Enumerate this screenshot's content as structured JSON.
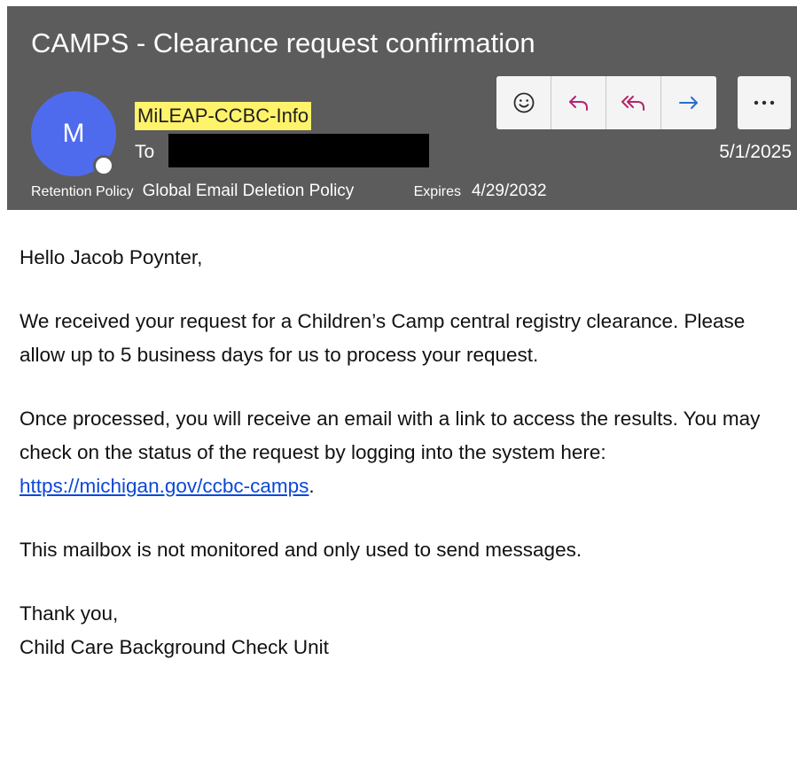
{
  "email": {
    "subject": "CAMPS - Clearance request confirmation",
    "avatar_initial": "M",
    "sender": "MiLEAP-CCBC-Info",
    "to_label": "To",
    "date": "5/1/2025",
    "retention_label": "Retention Policy",
    "retention_policy": "Global Email Deletion Policy",
    "expires_label": "Expires",
    "expires_date": "4/29/2032"
  },
  "toolbar": {
    "icons": [
      "emoji-icon",
      "reply-icon",
      "reply-all-icon",
      "forward-icon",
      "more-icon"
    ],
    "more_label": "..."
  },
  "body": {
    "greeting": "Hello Jacob Poynter,",
    "paragraph1": "We received your request for a Children’s Camp central registry clearance. Please allow up to 5 business days for us to process your request.",
    "paragraph2_pre": "Once processed, you will receive an email with a link to access the results. You may check on the status of the request by logging into the system here: ",
    "link_text": "https://michigan.gov/ccbc-camps",
    "paragraph2_post": ".",
    "paragraph3": "This mailbox is not monitored and only used to send messages.",
    "signoff": "Thank you,",
    "signature": "Child Care Background Check Unit"
  },
  "colors": {
    "header_bg": "#5c5c5c",
    "avatar_bg": "#4f6bed",
    "sender_highlight": "#fff36b",
    "reply_icon": "#b4246e",
    "forward_icon": "#2a6dc9",
    "link": "#0b48d6"
  }
}
